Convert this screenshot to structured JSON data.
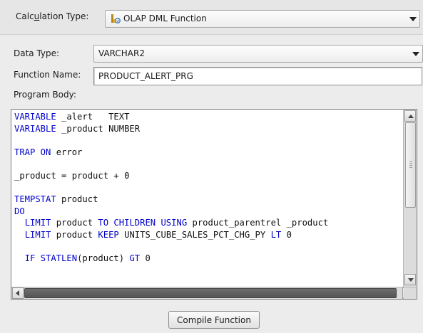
{
  "calculation_type": {
    "label": "Calculation Type:",
    "value": "OLAP DML Function",
    "icon": "olap-function-icon"
  },
  "data_type": {
    "label": "Data Type:",
    "value": "VARCHAR2"
  },
  "function_name": {
    "label": "Function Name:",
    "value": "PRODUCT_ALERT_PRG"
  },
  "program_body": {
    "label": "Program Body:",
    "lines": [
      [
        {
          "t": "VARIABLE",
          "k": true
        },
        {
          "t": " _alert   TEXT"
        }
      ],
      [
        {
          "t": "VARIABLE",
          "k": true
        },
        {
          "t": " _product NUMBER"
        }
      ],
      [],
      [
        {
          "t": "TRAP ON",
          "k": true
        },
        {
          "t": " error"
        }
      ],
      [],
      [
        {
          "t": "_product = product + 0"
        }
      ],
      [],
      [
        {
          "t": "TEMPSTAT",
          "k": true
        },
        {
          "t": " product"
        }
      ],
      [
        {
          "t": "DO",
          "k": true
        }
      ],
      [
        {
          "t": "  "
        },
        {
          "t": "LIMIT",
          "k": true
        },
        {
          "t": " product "
        },
        {
          "t": "TO CHILDREN USING",
          "k": true
        },
        {
          "t": " product_parentrel _product"
        }
      ],
      [
        {
          "t": "  "
        },
        {
          "t": "LIMIT",
          "k": true
        },
        {
          "t": " product "
        },
        {
          "t": "KEEP",
          "k": true
        },
        {
          "t": " UNITS_CUBE_SALES_PCT_CHG_PY "
        },
        {
          "t": "LT",
          "k": true
        },
        {
          "t": " 0"
        }
      ],
      [],
      [
        {
          "t": "  "
        },
        {
          "t": "IF STATLEN",
          "k": true
        },
        {
          "t": "(product) "
        },
        {
          "t": "GT",
          "k": true
        },
        {
          "t": " 0"
        }
      ]
    ],
    "keyword_color": "#0000cc"
  },
  "compile_button": {
    "label": "Compile Function"
  }
}
